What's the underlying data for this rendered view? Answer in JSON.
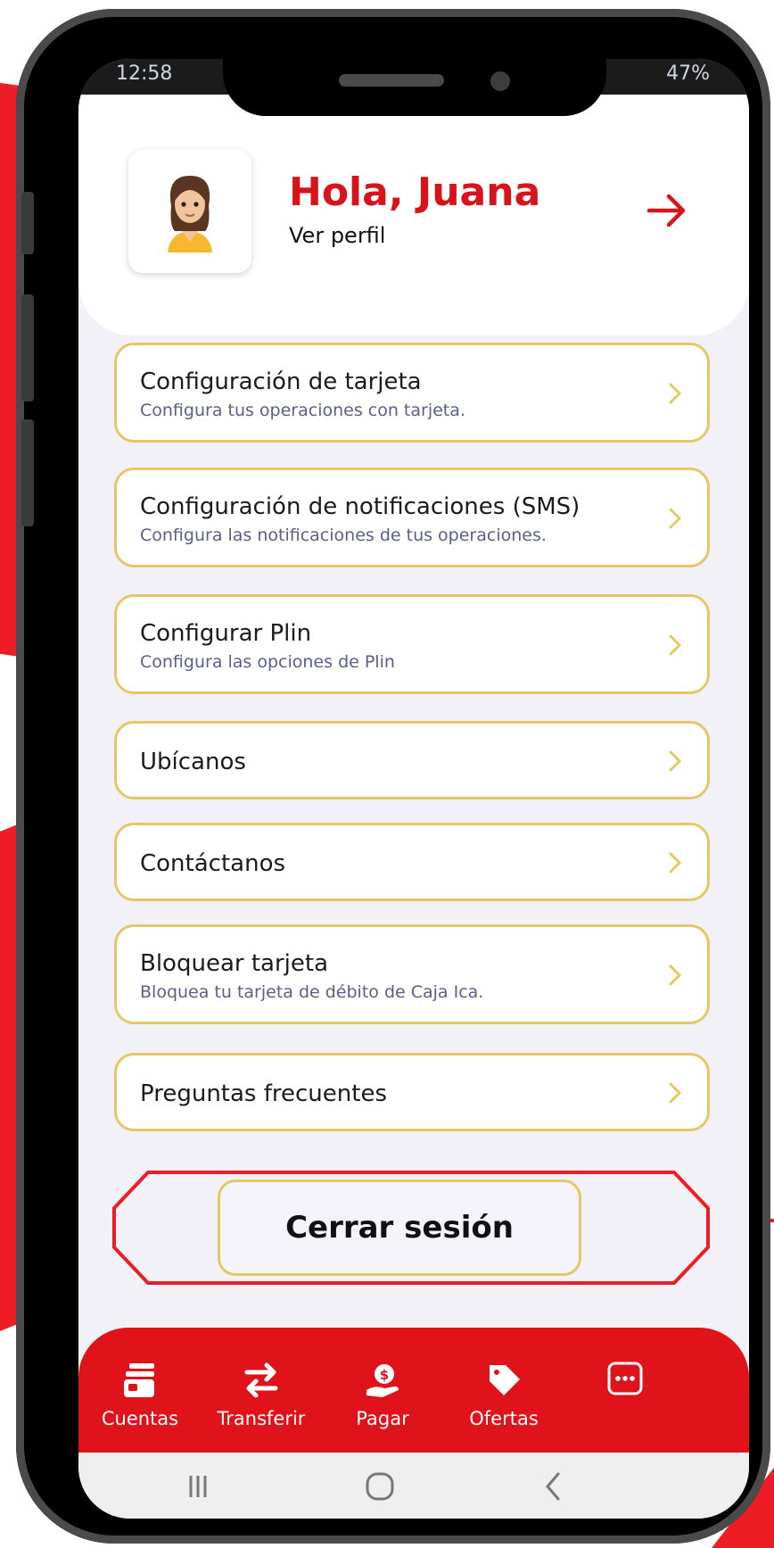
{
  "status_bar": {
    "time": "12:58",
    "battery": "47%"
  },
  "header": {
    "greeting": "Hola, Juana",
    "profile_link": "Ver perfil"
  },
  "menu": [
    {
      "title": "Configuración de tarjeta",
      "subtitle": "Configura tus operaciones con tarjeta."
    },
    {
      "title": "Configuración de notificaciones (SMS)",
      "subtitle": "Configura las notificaciones de tus operaciones."
    },
    {
      "title": "Configurar Plin",
      "subtitle": "Configura las opciones de Plin"
    },
    {
      "title": "Ubícanos"
    },
    {
      "title": "Contáctanos"
    },
    {
      "title": "Bloquear tarjeta",
      "subtitle": "Bloquea tu tarjeta de débito de Caja Ica."
    },
    {
      "title": "Preguntas frecuentes"
    }
  ],
  "logout_label": "Cerrar sesión",
  "bottom_nav": [
    {
      "label": "Cuentas",
      "icon": "cards-icon"
    },
    {
      "label": "Transferir",
      "icon": "transfer-icon"
    },
    {
      "label": "Pagar",
      "icon": "pay-icon"
    },
    {
      "label": "Ofertas",
      "icon": "tag-icon"
    },
    {
      "label": "",
      "icon": "more-icon"
    }
  ],
  "colors": {
    "brand_red": "#e0121a",
    "accent_gold": "#e5c865",
    "greeting_red": "#d8131c"
  }
}
